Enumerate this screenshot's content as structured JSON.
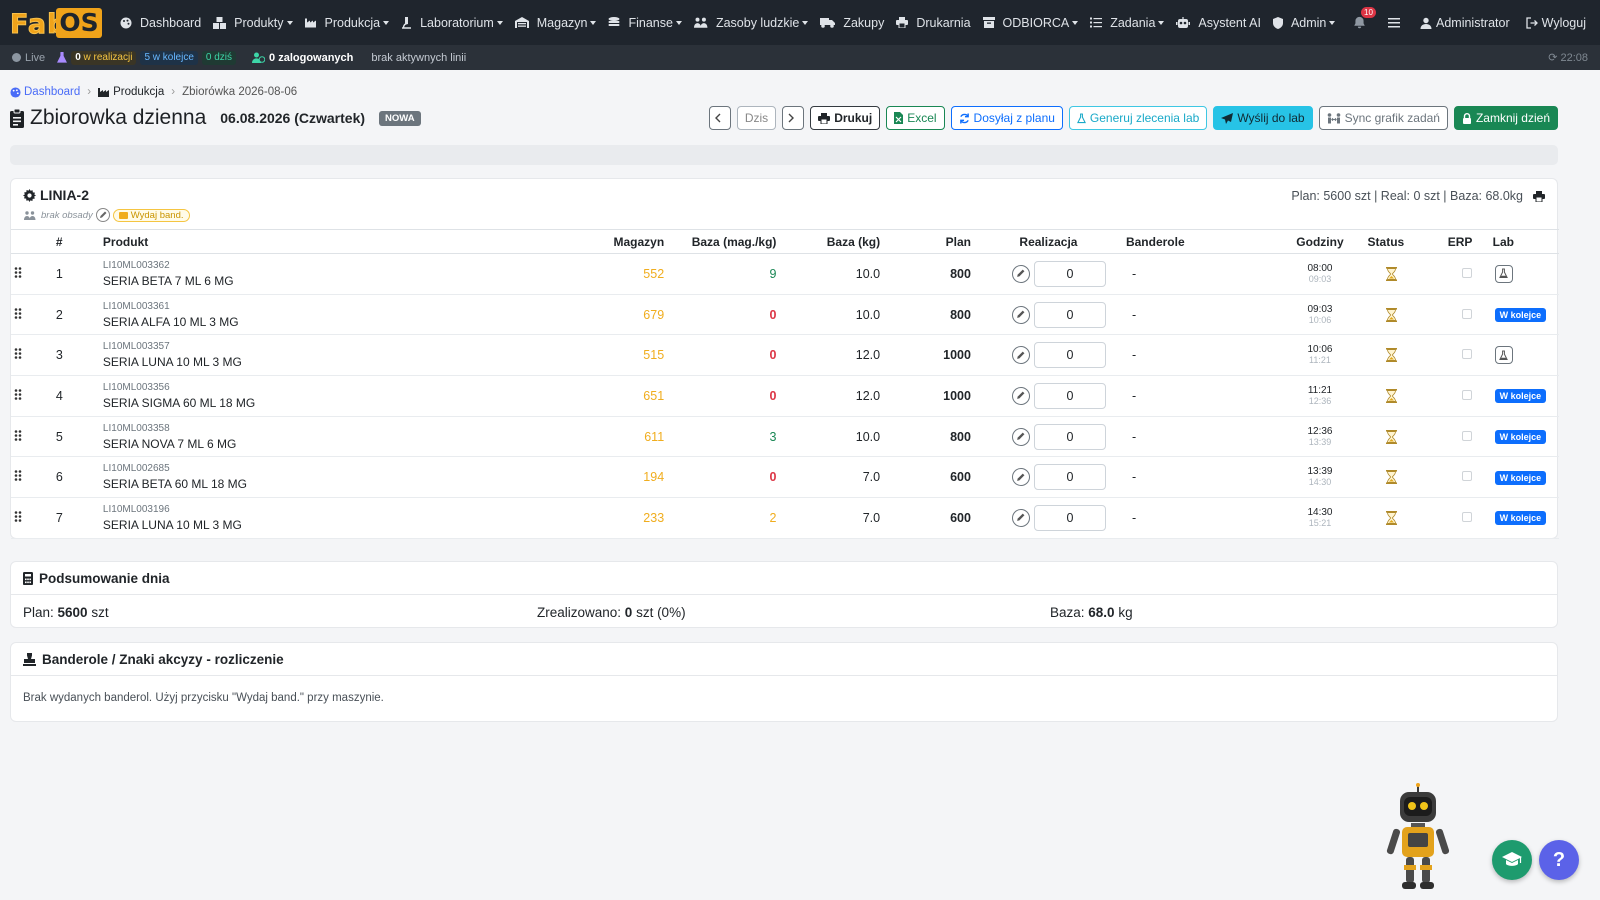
{
  "brand": {
    "fab": "Fab",
    "os": "OS"
  },
  "nav": {
    "items": [
      {
        "label": "Dashboard",
        "icon": "palette-icon",
        "dropdown": false
      },
      {
        "label": "Produkty",
        "icon": "cubes-icon",
        "dropdown": true
      },
      {
        "label": "Produkcja",
        "icon": "industry-icon",
        "dropdown": true
      },
      {
        "label": "Laboratorium",
        "icon": "microscope-icon",
        "dropdown": true
      },
      {
        "label": "Magazyn",
        "icon": "warehouse-icon",
        "dropdown": true
      },
      {
        "label": "Finanse",
        "icon": "coins-icon",
        "dropdown": true
      },
      {
        "label": "Zasoby ludzkie",
        "icon": "users-icon",
        "dropdown": true
      },
      {
        "label": "Zakupy",
        "icon": "truck-icon",
        "dropdown": false
      },
      {
        "label": "Drukarnia",
        "icon": "printer-icon",
        "dropdown": false
      },
      {
        "label": "ODBIORCA",
        "icon": "box-icon",
        "dropdown": true
      },
      {
        "label": "Zadania",
        "icon": "tasks-icon",
        "dropdown": true
      },
      {
        "label": "Asystent AI",
        "icon": "robot-icon",
        "dropdown": false
      },
      {
        "label": "Admin",
        "icon": "shield-icon",
        "dropdown": true
      }
    ],
    "notifications": "10",
    "user": "Administrator",
    "logout": "Wyloguj"
  },
  "statusbar": {
    "live": "Live",
    "in_progress_num": "0",
    "in_progress_label": " w realizacji",
    "queue": "5 w kolejce",
    "today": "0 dziś",
    "logged": "0 zalogowanych",
    "lines": "brak aktywnych linii",
    "time": "⟳ 22:08"
  },
  "breadcrumb": {
    "home": "Dashboard",
    "section": "Produkcja",
    "current": "Zbiorówka 2026-08-06"
  },
  "header": {
    "title": "Zbiorowka dzienna",
    "date": "06.08.2026 (Czwartek)",
    "status": "NOWA"
  },
  "toolbar": {
    "today": "Dzis",
    "print": "Drukuj",
    "excel": "Excel",
    "send_plan": "Dosyłaj z planu",
    "gen_lab": "Generuj zlecenia lab",
    "send_lab": "Wyślij do lab",
    "sync": "Sync grafik zadań",
    "close_day": "Zamknij dzień"
  },
  "line": {
    "name": "LINIA-2",
    "crew": "brak obsady",
    "issue_band": "Wydaj band.",
    "summary": "Plan: 5600 szt | Real: 0 szt | Baza: 68.0kg",
    "columns": [
      "#",
      "Produkt",
      "Magazyn",
      "Baza (mag./kg)",
      "Baza (kg)",
      "Plan",
      "Realizacja",
      "Banderole",
      "Godziny",
      "Status",
      "ERP",
      "Lab"
    ],
    "rows": [
      {
        "num": "1",
        "code": "LI10ML003362",
        "name": "SERIA BETA 7 ML 6 MG",
        "mag": "552",
        "baza_mag": "9",
        "baza_type": "pos",
        "baza_kg": "10.0",
        "plan": "800",
        "real": "0",
        "band": "-",
        "start": "08:00",
        "end": "09:03",
        "lab": "flask"
      },
      {
        "num": "2",
        "code": "LI10ML003361",
        "name": "SERIA ALFA 10 ML 3 MG",
        "mag": "679",
        "baza_mag": "0",
        "baza_type": "zero",
        "baza_kg": "10.0",
        "plan": "800",
        "real": "0",
        "band": "-",
        "start": "09:03",
        "end": "10:06",
        "lab": "W kolejce"
      },
      {
        "num": "3",
        "code": "LI10ML003357",
        "name": "SERIA LUNA 10 ML 3 MG",
        "mag": "515",
        "baza_mag": "0",
        "baza_type": "zero",
        "baza_kg": "12.0",
        "plan": "1000",
        "real": "0",
        "band": "-",
        "start": "10:06",
        "end": "11:21",
        "lab": "flask"
      },
      {
        "num": "4",
        "code": "LI10ML003356",
        "name": "SERIA SIGMA 60 ML 18 MG",
        "mag": "651",
        "baza_mag": "0",
        "baza_type": "zero",
        "baza_kg": "12.0",
        "plan": "1000",
        "real": "0",
        "band": "-",
        "start": "11:21",
        "end": "12:36",
        "lab": "W kolejce"
      },
      {
        "num": "5",
        "code": "LI10ML003358",
        "name": "SERIA NOVA 7 ML 6 MG",
        "mag": "611",
        "baza_mag": "3",
        "baza_type": "pos",
        "baza_kg": "10.0",
        "plan": "800",
        "real": "0",
        "band": "-",
        "start": "12:36",
        "end": "13:39",
        "lab": "W kolejce"
      },
      {
        "num": "6",
        "code": "LI10ML002685",
        "name": "SERIA BETA 60 ML 18 MG",
        "mag": "194",
        "baza_mag": "0",
        "baza_type": "zero",
        "baza_kg": "7.0",
        "plan": "600",
        "real": "0",
        "band": "-",
        "start": "13:39",
        "end": "14:30",
        "lab": "W kolejce"
      },
      {
        "num": "7",
        "code": "LI10ML003196",
        "name": "SERIA LUNA 10 ML 3 MG",
        "mag": "233",
        "baza_mag": "2",
        "baza_type": "warn",
        "baza_kg": "7.0",
        "plan": "600",
        "real": "0",
        "band": "-",
        "start": "14:30",
        "end": "15:21",
        "lab": "W kolejce"
      }
    ]
  },
  "summary": {
    "title": "Podsumowanie dnia",
    "plan_label": "Plan: ",
    "plan_value": "5600",
    "plan_unit": " szt",
    "done_label": "Zrealizowano: ",
    "done_value": "0",
    "done_unit": " szt (0%)",
    "base_label": "Baza: ",
    "base_value": "68.0",
    "base_unit": " kg"
  },
  "banderole": {
    "title": "Banderole / Znaki akcyzy - rozliczenie",
    "text": "Brak wydanych banderol. Użyj przycisku \"Wydaj band.\" przy maszynie."
  },
  "help": "?"
}
